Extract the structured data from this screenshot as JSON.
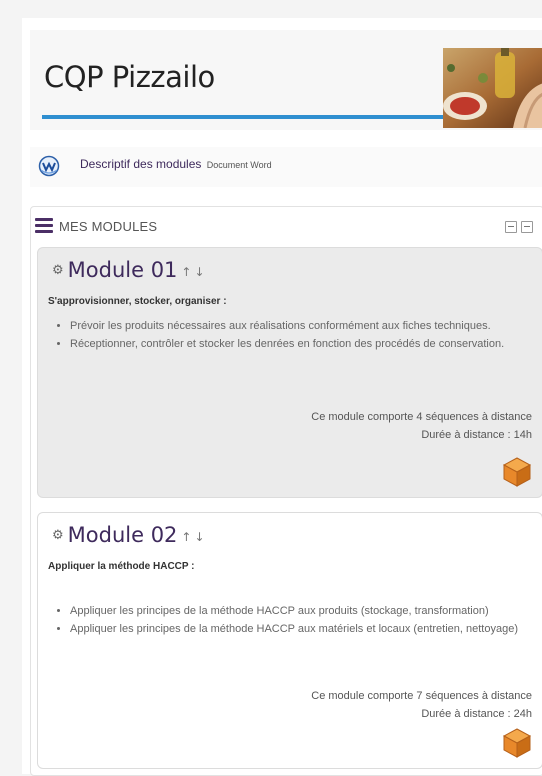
{
  "header": {
    "site_title": "CQP Pizzailo"
  },
  "resource": {
    "name": "Descriptif des modules",
    "type": "Document Word"
  },
  "block": {
    "title": "MES MODULES"
  },
  "modules": [
    {
      "title": "Module 01",
      "subtitle": "S'approvisionner, stocker, organiser :",
      "bullets": [
        "Prévoir les produits nécessaires aux réalisations conformément aux fiches techniques.",
        "Réceptionner, contrôler et stocker les denrées en fonction des procédés de conservation."
      ],
      "sequences": "Ce module comporte 4 séquences à distance",
      "duration": "Durée à distance : 14h"
    },
    {
      "title": "Module 02",
      "subtitle": "Appliquer la méthode HACCP :",
      "bullets": [
        "Appliquer les principes de la méthode HACCP aux produits (stockage, transformation)",
        "Appliquer les principes de la méthode HACCP aux matériels et locaux (entretien, nettoyage)"
      ],
      "sequences": "Ce module comporte 7 séquences à distance",
      "duration": "Durée à distance : 24h"
    }
  ],
  "icons": {
    "menu": "hamburger-icon",
    "doc": "word-document-icon",
    "module": "gear-icon",
    "move_up": "arrow-up-icon",
    "move_down": "arrow-down-icon",
    "activity": "cube-icon"
  },
  "colors": {
    "accent": "#2f8fd0",
    "title": "#3e2a5c",
    "cube": "#e8882a"
  }
}
